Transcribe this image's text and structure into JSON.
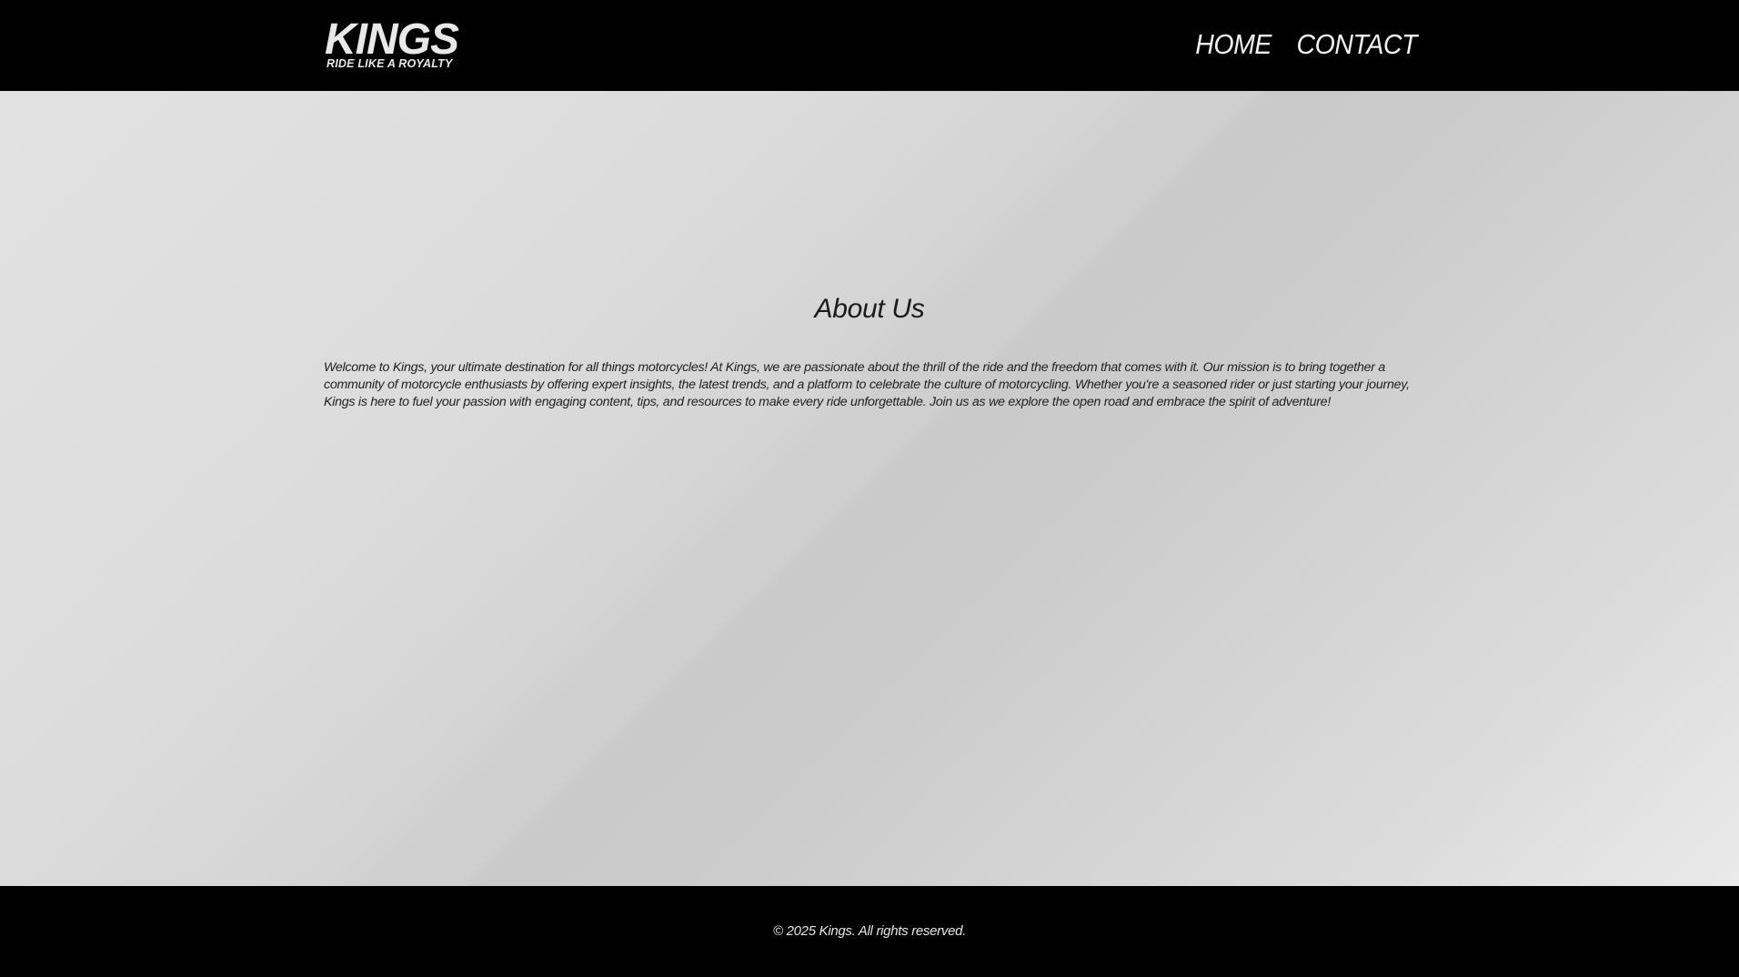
{
  "header": {
    "logo": {
      "word": "KINGS",
      "tagline": "RIDE LIKE A ROYALTY"
    },
    "nav": [
      {
        "label": "HOME"
      },
      {
        "label": "CONTACT"
      }
    ]
  },
  "main": {
    "title": "About Us",
    "paragraph": "Welcome to Kings, your ultimate destination for all things motorcycles! At Kings, we are passionate about the thrill of the ride and the freedom that comes with it. Our mission is to bring together a community of motorcycle enthusiasts by offering expert insights, the latest trends, and a platform to celebrate the culture of motorcycling. Whether you're a seasoned rider or just starting your journey, Kings is here to fuel your passion with engaging content, tips, and resources to make every ride unforgettable. Join us as we explore the open road and embrace the spirit of adventure!"
  },
  "footer": {
    "copyright": "© 2025 Kings. All rights reserved."
  },
  "colors": {
    "header_bg": "#000000",
    "footer_bg": "#000000",
    "logo": "#e8e8e8",
    "nav_text": "#f2f2f2",
    "body_text": "#1f1f1f"
  }
}
